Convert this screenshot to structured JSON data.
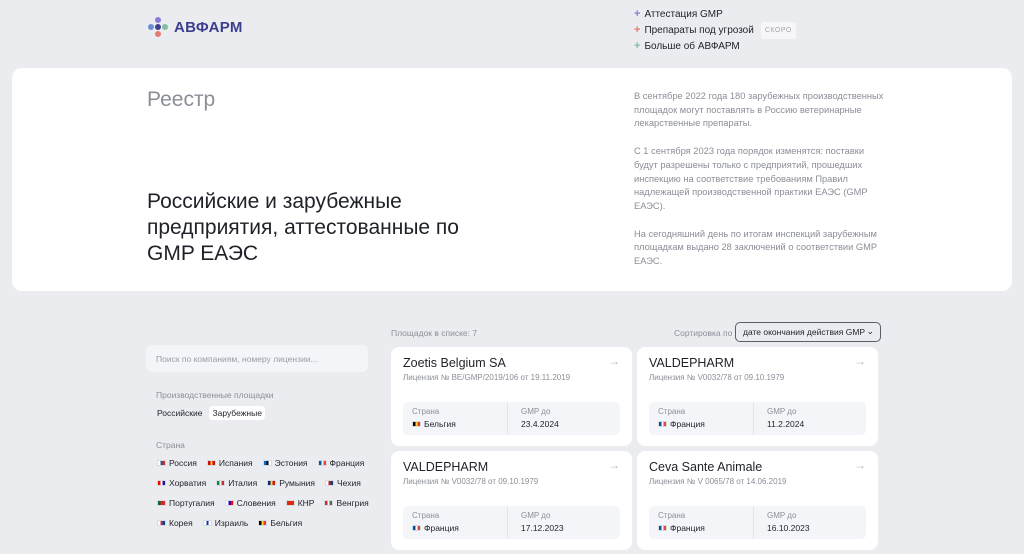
{
  "header": {
    "logo_text": "АВФАРМ",
    "nav": [
      {
        "label": "Аттестация GMP",
        "plus_color": "#8d7ad6",
        "badge": ""
      },
      {
        "label": "Препараты под угрозой",
        "plus_color": "#e8796f",
        "badge": "СКОРО"
      },
      {
        "label": "Больше об АВФАРМ",
        "plus_color": "#7fbf9d",
        "badge": ""
      }
    ]
  },
  "hero": {
    "section": "Реестр",
    "title": "Российские и зарубежные предприятия, аттестованные по GMP ЕАЭС",
    "paragraphs": [
      "В сентябре 2022 года 180 зарубежных производственных площадок могут поставлять в Россию ветеринарные лекарственные препараты.",
      "С 1 сентября 2023 года порядок изменятся: поставки будут разрешены только с предприятий, прошедших инспекцию на соответствие требованиям Правил надлежащей производственной практики ЕАЭС (GMP ЕАЭС).",
      "На сегодняшний день по итогам инспекций зарубежным площадкам выдано 28 заключений о соответствии GMP ЕАЭС."
    ]
  },
  "sidebar": {
    "search_placeholder": "Поиск по компаниям, номеру лицензии...",
    "sites_title": "Производственные площадки",
    "sites": [
      {
        "label": "Российские",
        "active": false
      },
      {
        "label": "Зарубежные",
        "active": true
      }
    ],
    "country_title": "Страна",
    "countries": [
      {
        "label": "Россия",
        "flag": [
          "#ffffff",
          "#1c57a5",
          "#d52b1e"
        ]
      },
      {
        "label": "Испания",
        "flag": [
          "#c60b1e",
          "#ffc400",
          "#c60b1e"
        ]
      },
      {
        "label": "Эстония",
        "flag": [
          "#0072ce",
          "#000000",
          "#ffffff"
        ]
      },
      {
        "label": "Франция",
        "flag": [
          "#0055a4",
          "#ffffff",
          "#ef4135"
        ]
      },
      {
        "label": "Хорватия",
        "flag": [
          "#ff0000",
          "#ffffff",
          "#171796"
        ]
      },
      {
        "label": "Италия",
        "flag": [
          "#009246",
          "#ffffff",
          "#ce2b37"
        ]
      },
      {
        "label": "Румыния",
        "flag": [
          "#002b7f",
          "#fcd116",
          "#ce1126"
        ]
      },
      {
        "label": "Чехия",
        "flag": [
          "#ffffff",
          "#d7141a",
          "#11457e"
        ]
      },
      {
        "label": "Португалия",
        "flag": [
          "#046a38",
          "#da291c",
          "#da291c"
        ]
      },
      {
        "label": "Словения",
        "flag": [
          "#ffffff",
          "#0000ff",
          "#ff0000"
        ]
      },
      {
        "label": "КНР",
        "flag": [
          "#de2910",
          "#de2910",
          "#de2910"
        ]
      },
      {
        "label": "Венгрия",
        "flag": [
          "#ce2939",
          "#ffffff",
          "#477050"
        ]
      },
      {
        "label": "Корея",
        "flag": [
          "#ffffff",
          "#cd2e3a",
          "#0047a0"
        ]
      },
      {
        "label": "Израиль",
        "flag": [
          "#ffffff",
          "#0038b8",
          "#ffffff"
        ]
      },
      {
        "label": "Бельгия",
        "flag": [
          "#000000",
          "#fdda24",
          "#ef3340"
        ]
      }
    ]
  },
  "results": {
    "count_label": "Площадок в списке: 7",
    "sort_label": "Сортировка по",
    "sort_value": "дате окончания действия GMP",
    "country_label": "Страна",
    "gmp_label": "GMP до",
    "cards": [
      {
        "name": "Zoetis Belgium SA",
        "license": "Лицензия № BE/GMP/2019/106 от 19.11.2019",
        "country": "Бельгия",
        "flag": [
          "#000000",
          "#fdda24",
          "#ef3340"
        ],
        "gmp_until": "23.4.2024"
      },
      {
        "name": "VALDEPHARM",
        "license": "Лицензия № V0032/78 от 09.10.1979",
        "country": "Франция",
        "flag": [
          "#0055a4",
          "#ffffff",
          "#ef4135"
        ],
        "gmp_until": "11.2.2024"
      },
      {
        "name": "VALDEPHARM",
        "license": "Лицензия № V0032/78 от 09.10.1979",
        "country": "Франция",
        "flag": [
          "#0055a4",
          "#ffffff",
          "#ef4135"
        ],
        "gmp_until": "17.12.2023"
      },
      {
        "name": "Ceva Sante Animale",
        "license": "Лицензия № V 0065/78 от 14.06.2019",
        "country": "Франция",
        "flag": [
          "#0055a4",
          "#ffffff",
          "#ef4135"
        ],
        "gmp_until": "16.10.2023"
      }
    ]
  }
}
